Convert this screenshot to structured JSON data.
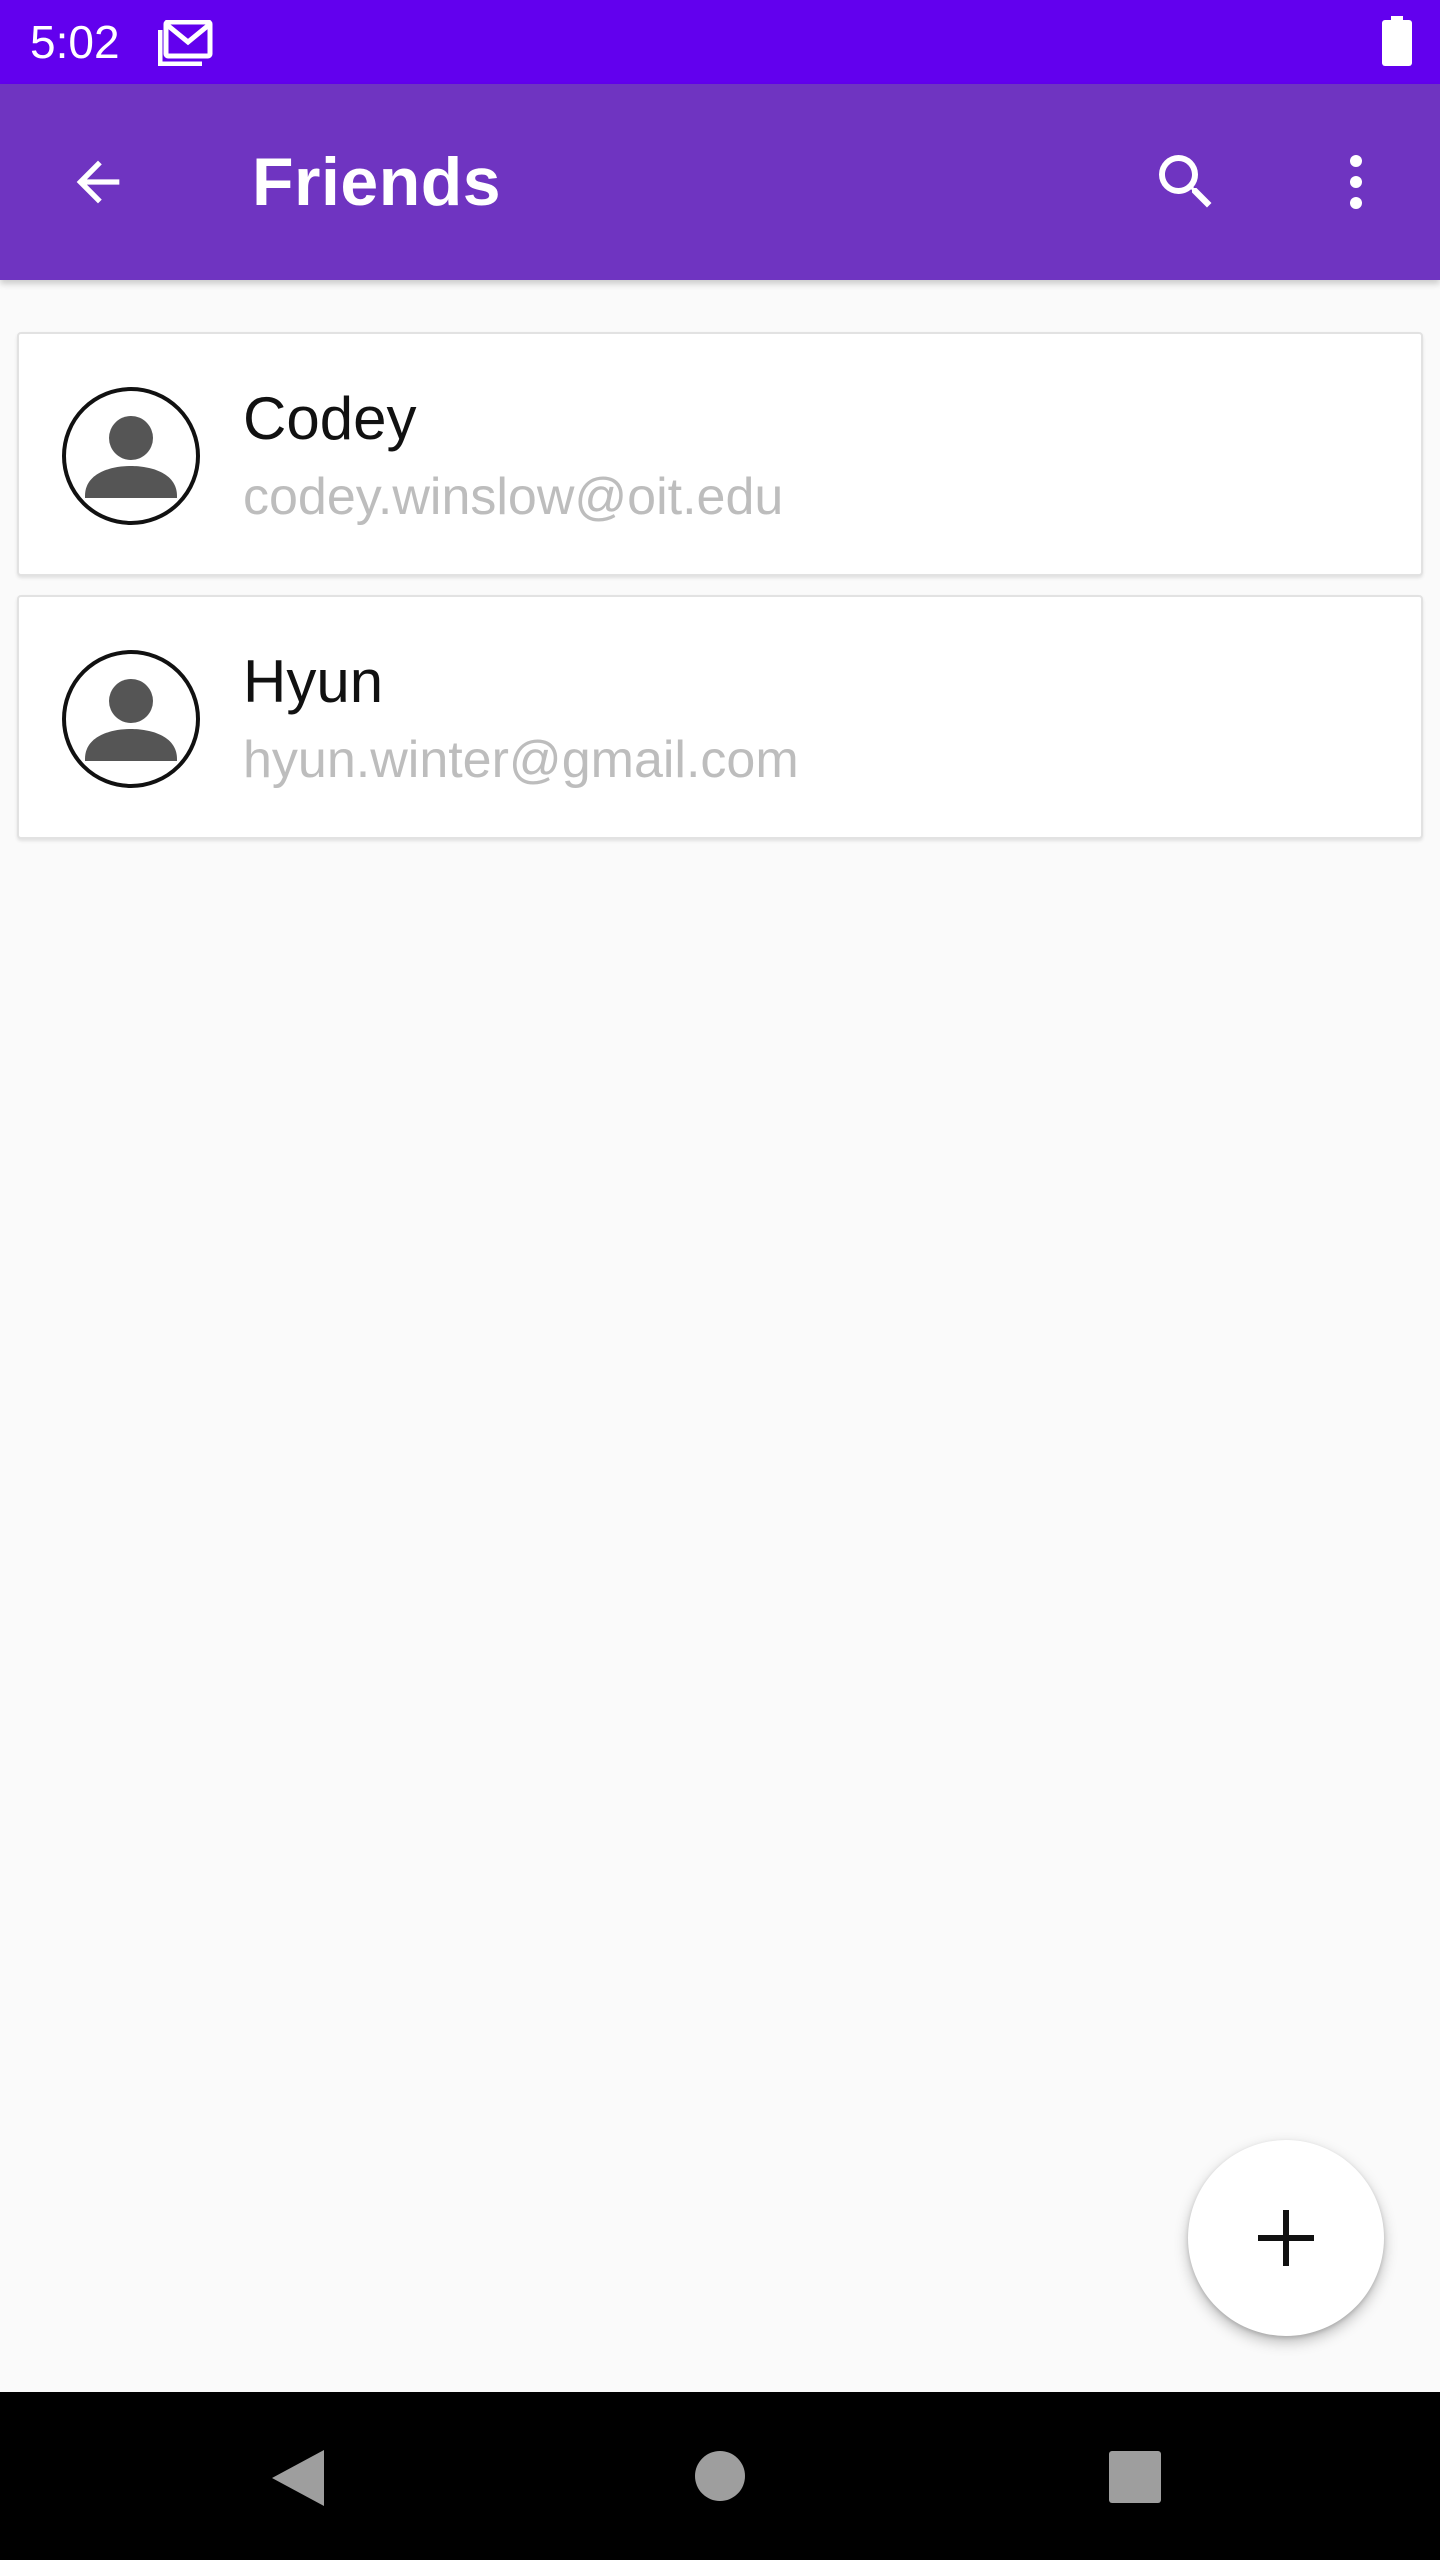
{
  "status_bar": {
    "time": "5:02",
    "icons": [
      "gmail-icon",
      "battery-icon"
    ]
  },
  "app_bar": {
    "title": "Friends",
    "icons": [
      "arrow-back-icon",
      "search-icon",
      "more-vert-icon"
    ]
  },
  "friends": [
    {
      "name": "Codey",
      "email": "codey.winslow@oit.edu",
      "icon": "person-icon"
    },
    {
      "name": "Hyun",
      "email": "hyun.winter@gmail.com",
      "icon": "person-icon"
    }
  ],
  "fab": {
    "icon": "add-icon"
  },
  "nav_bar": {
    "icons": [
      "nav-back-icon",
      "nav-home-icon",
      "nav-recents-icon"
    ]
  },
  "colors": {
    "status_bar": "#6200ee",
    "app_bar": "#6f34c1",
    "background": "#fafafa",
    "email_text": "#bdbdbd"
  }
}
